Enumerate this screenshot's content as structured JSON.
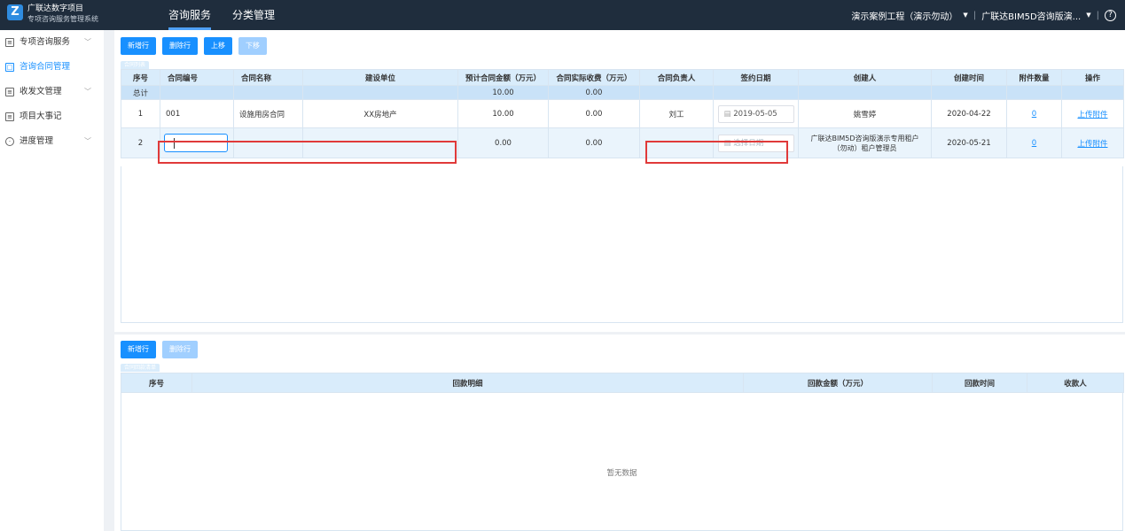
{
  "header": {
    "brand_line1": "广联达数字项目",
    "brand_line2": "专项咨询服务管理系统",
    "logo_letter": "Z",
    "nav": [
      "咨询服务",
      "分类管理"
    ],
    "project_selector": "演示案例工程（演示勿动）",
    "account_selector": "广联达BIM5D咨询版演...",
    "dropdown_glyph": "▼",
    "separator": "|",
    "help_glyph": "?"
  },
  "sidebar": {
    "items": [
      {
        "label": "专项咨询服务",
        "icon": "document-icon",
        "has_chevron": true
      },
      {
        "label": "咨询合同管理",
        "icon": "contract-icon",
        "has_chevron": false
      },
      {
        "label": "收发文管理",
        "icon": "folder-icon",
        "has_chevron": true
      },
      {
        "label": "项目大事记",
        "icon": "notes-icon",
        "has_chevron": false
      },
      {
        "label": "进度管理",
        "icon": "clock-icon",
        "has_chevron": true
      }
    ],
    "active_index": 1,
    "chevron_glyph": "﹀"
  },
  "contract_toolbar": {
    "buttons": [
      {
        "label": "新增行",
        "disabled": false
      },
      {
        "label": "删除行",
        "disabled": false
      },
      {
        "label": "上移",
        "disabled": false
      },
      {
        "label": "下移",
        "disabled": true
      }
    ],
    "tab_caption": "合同列表"
  },
  "contract_table": {
    "columns": [
      "序号",
      "合同编号",
      "合同名称",
      "建设单位",
      "预计合同金额（万元）",
      "合同实际收费（万元）",
      "合同负责人",
      "签约日期",
      "创建人",
      "创建时间",
      "附件数量",
      "操作"
    ],
    "total_row": {
      "label": "总计",
      "estimated_amount": "10.00",
      "actual_fee": "0.00"
    },
    "rows": [
      {
        "index": "1",
        "contract_no": "001",
        "contract_name": "设施用房合同",
        "construction_unit": "XX房地产",
        "estimated_amount": "10.00",
        "actual_fee": "0.00",
        "manager": "刘工",
        "sign_date": "2019-05-05",
        "creator": "姚雪婷",
        "created_at": "2020-04-22",
        "attachments": "0",
        "action": "上传附件"
      },
      {
        "index": "2",
        "contract_no": "",
        "contract_name": "",
        "construction_unit": "",
        "estimated_amount": "0.00",
        "actual_fee": "0.00",
        "manager": "",
        "sign_date_placeholder": "选择日期",
        "creator": "广联达BIM5D咨询版演示专用租户（勿动）租户管理员",
        "creator_line1": "广联达BIM5D咨询版演示专用租户",
        "creator_line2": "（勿动）租户管理员",
        "created_at": "2020-05-21",
        "attachments": "0",
        "action": "上传附件"
      }
    ]
  },
  "payment_toolbar": {
    "buttons": [
      {
        "label": "新增行",
        "disabled": false
      },
      {
        "label": "删除行",
        "disabled": true
      }
    ],
    "tab_caption": "合同回款清单"
  },
  "payment_table": {
    "columns": [
      "序号",
      "回款明细",
      "回款金额（万元）",
      "回款时间",
      "收款人"
    ],
    "empty_text": "暂无数据"
  },
  "colors": {
    "header_bg": "#1f2d3d",
    "accent": "#1890ff",
    "highlight_border": "#e03a3a"
  }
}
